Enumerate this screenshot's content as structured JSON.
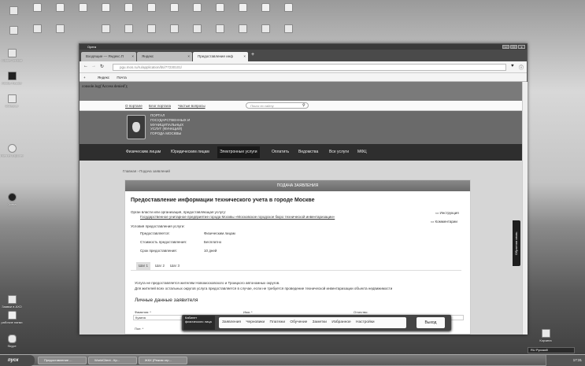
{
  "desktop": {
    "icons_left": [
      "Adobe Acrobat",
      "Adobe Reader",
      "CCleaner",
      "Opera",
      "Internet Explorer",
      "Заявки в АХО",
      "рабочие папки",
      "Skype"
    ],
    "recycle_bin": "Корзина"
  },
  "browser": {
    "app": "Opera",
    "tabs": [
      {
        "label": "Входящие — Яндекс.П"
      },
      {
        "label": "Яндекс"
      },
      {
        "label": "Предоставление инф"
      }
    ],
    "new_tab": "+",
    "url": "pgu.mos.ru/ru/application/bti/77230101/",
    "bookmarks": [
      "Яндекс",
      "Почта"
    ]
  },
  "page": {
    "console": "console.log('Access denied');",
    "top_links": [
      "О портале",
      "Блог портала",
      "Частые вопросы"
    ],
    "search_placeholder": "Поиск по сайту",
    "portal_name": [
      "ПОРТАЛ",
      "ГОСУДАРСТВЕННЫХ И",
      "МУНИЦИПАЛЬНЫХ",
      "УСЛУГ (ФУНКЦИЙ)",
      "ГОРОДА МОСКВЫ"
    ],
    "nav": [
      "Физическим лицам",
      "Юридическим лицам",
      "Электронные услуги",
      "Оплатить",
      "Ведомства",
      "Все услуги",
      "МФЦ"
    ],
    "breadcrumb": [
      "Главная",
      "Подача заявлений"
    ],
    "panel_header": "ПОДАЧА ЗАЯВЛЕНИЯ",
    "title": "Предоставление информации технического учета в городе Москве",
    "org_label": "Орган власти или организация, предоставляющая услугу:",
    "org_value": "Государственное унитарное предприятие города Москвы «Московское городское бюро технической инвентаризации»",
    "instruction": "Инструкция",
    "comments": "Комментарии",
    "conditions_label": "Условия предоставления услуги:",
    "conditions": [
      {
        "k": "Предоставляется:",
        "v": "Физическим лицам"
      },
      {
        "k": "Стоимость предоставления:",
        "v": "Бесплатно"
      },
      {
        "k": "Срок предоставления:",
        "v": "10 дней"
      }
    ],
    "steps": [
      "Шаг 1",
      "Шаг 2",
      "Шаг 3"
    ],
    "notice1": "Услуга не предоставляется жителям Новомосковского и Троицкого автономных округов.",
    "notice2": "Для жителей всех остальных округов услуга предоставляется в случае, если не требуется проведение технической инвентаризации объекта недвижимости",
    "section": "Личные данные заявителя",
    "fields": {
      "surname_label": "Фамилия: *",
      "surname_value": "Кузина",
      "name_label": "Имя: *",
      "patronymic_label": "Отчество:",
      "gender_label": "Пол: *"
    },
    "feedback": "Обратная связь"
  },
  "cabinet": {
    "label": "Кабинет физического лица",
    "menu": [
      "Заявления",
      "Черновики",
      "Платежи",
      "Обучение",
      "Заметки",
      "Избранное",
      "Настройки"
    ],
    "exit": "Выход"
  },
  "taskbar": {
    "start": "пуск",
    "tasks": [
      "Предоставление ...",
      "WorldClient - Кр...",
      "ЖКХ (Режим огр..."
    ],
    "lang": "RU Русский",
    "time": "17:31"
  }
}
